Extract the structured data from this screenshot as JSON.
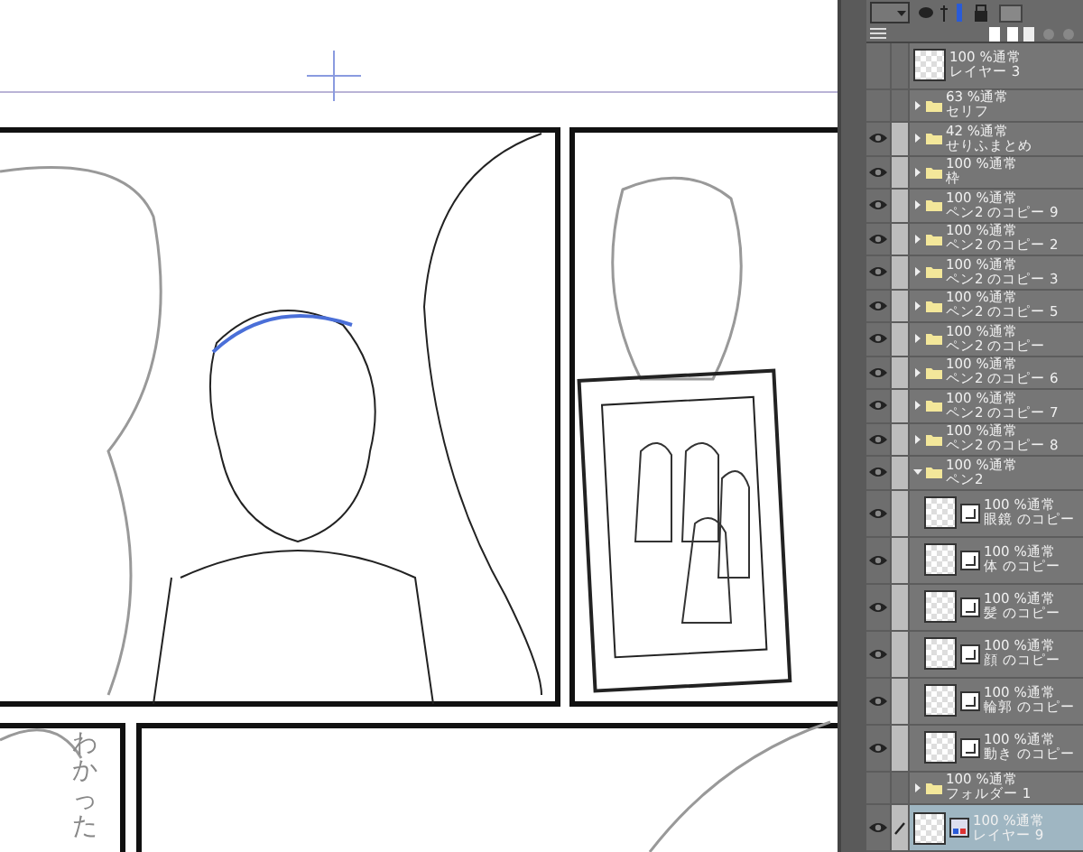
{
  "canvas": {
    "handwritten_text": "わかった"
  },
  "layers": [
    {
      "kind": "layer",
      "mode": "100 %通常",
      "name": "レイヤー 3",
      "visible": false,
      "selected": false
    },
    {
      "kind": "folder",
      "mode": "63 %通常",
      "name": "セリフ",
      "visible": false,
      "selected": false,
      "expanded": false
    },
    {
      "kind": "folder",
      "mode": "42 %通常",
      "name": "せりふまとめ",
      "visible": true,
      "selected": false,
      "expanded": false
    },
    {
      "kind": "folder",
      "mode": "100 %通常",
      "name": "枠",
      "visible": true,
      "selected": false,
      "expanded": false
    },
    {
      "kind": "folder",
      "mode": "100 %通常",
      "name": "ペン2 のコピー 9",
      "visible": true,
      "selected": false,
      "expanded": false
    },
    {
      "kind": "folder",
      "mode": "100 %通常",
      "name": "ペン2 のコピー 2",
      "visible": true,
      "selected": false,
      "expanded": false
    },
    {
      "kind": "folder",
      "mode": "100 %通常",
      "name": "ペン2 のコピー 3",
      "visible": true,
      "selected": false,
      "expanded": false
    },
    {
      "kind": "folder",
      "mode": "100 %通常",
      "name": "ペン2 のコピー 5",
      "visible": true,
      "selected": false,
      "expanded": false
    },
    {
      "kind": "folder",
      "mode": "100 %通常",
      "name": "ペン2 のコピー",
      "visible": true,
      "selected": false,
      "expanded": false
    },
    {
      "kind": "folder",
      "mode": "100 %通常",
      "name": "ペン2 のコピー 6",
      "visible": true,
      "selected": false,
      "expanded": false
    },
    {
      "kind": "folder",
      "mode": "100 %通常",
      "name": "ペン2 のコピー 7",
      "visible": true,
      "selected": false,
      "expanded": false
    },
    {
      "kind": "folder",
      "mode": "100 %通常",
      "name": "ペン2 のコピー 8",
      "visible": true,
      "selected": false,
      "expanded": false
    },
    {
      "kind": "folder",
      "mode": "100 %通常",
      "name": "ペン2",
      "visible": true,
      "selected": false,
      "expanded": true,
      "children": [
        {
          "kind": "layer",
          "mode": "100 %通常",
          "name": "眼鏡 のコピー",
          "visible": true,
          "selected": false
        },
        {
          "kind": "layer",
          "mode": "100 %通常",
          "name": "体 のコピー",
          "visible": true,
          "selected": false
        },
        {
          "kind": "layer",
          "mode": "100 %通常",
          "name": "髪 のコピー",
          "visible": true,
          "selected": false
        },
        {
          "kind": "layer",
          "mode": "100 %通常",
          "name": "顔 のコピー",
          "visible": true,
          "selected": false
        },
        {
          "kind": "layer",
          "mode": "100 %通常",
          "name": "輪郭 のコピー",
          "visible": true,
          "selected": false
        },
        {
          "kind": "layer",
          "mode": "100 %通常",
          "name": "動き のコピー",
          "visible": true,
          "selected": false
        }
      ]
    },
    {
      "kind": "folder",
      "mode": "100 %通常",
      "name": "フォルダー 1",
      "visible": false,
      "selected": false,
      "expanded": false
    },
    {
      "kind": "layer",
      "mode": "100 %通常",
      "name": "レイヤー 9",
      "visible": true,
      "selected": true
    }
  ]
}
